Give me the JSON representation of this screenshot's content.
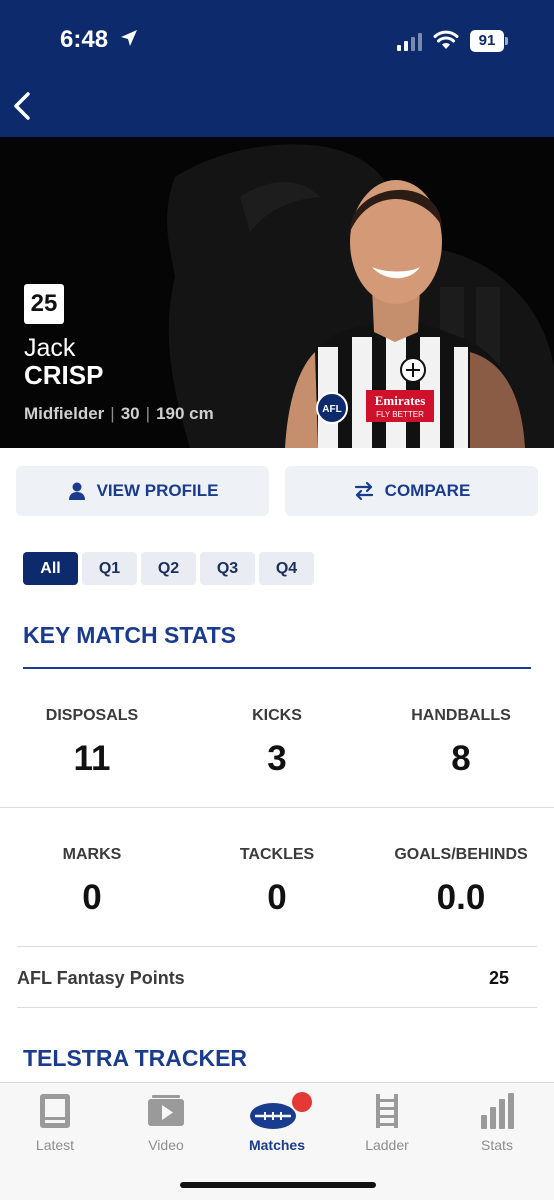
{
  "status_bar": {
    "time": "6:48",
    "battery": "91"
  },
  "player": {
    "number": "25",
    "first_name": "Jack",
    "last_name": "CRISP",
    "position": "Midfielder",
    "age": "30",
    "height": "190 cm",
    "photo_sponsor_text": "Emirates",
    "photo_sponsor_tagline": "FLY BETTER",
    "photo_logo_text": "AFL"
  },
  "actions": {
    "view_profile": "VIEW PROFILE",
    "compare": "COMPARE"
  },
  "quarters": {
    "selected": "All",
    "items": [
      "All",
      "Q1",
      "Q2",
      "Q3",
      "Q4"
    ]
  },
  "key_stats": {
    "title": "KEY MATCH STATS",
    "row1": [
      {
        "label": "DISPOSALS",
        "value": "11"
      },
      {
        "label": "KICKS",
        "value": "3"
      },
      {
        "label": "HANDBALLS",
        "value": "8"
      }
    ],
    "row2": [
      {
        "label": "MARKS",
        "value": "0"
      },
      {
        "label": "TACKLES",
        "value": "0"
      },
      {
        "label": "GOALS/BEHINDS",
        "value": "0.0"
      }
    ],
    "fantasy_label": "AFL Fantasy Points",
    "fantasy_value": "25"
  },
  "telstra_tracker": {
    "title": "TELSTRA TRACKER"
  },
  "tab_bar": {
    "active": "Matches",
    "items": [
      {
        "label": "Latest",
        "icon": "latest-icon"
      },
      {
        "label": "Video",
        "icon": "video-icon"
      },
      {
        "label": "Matches",
        "icon": "matches-football-icon"
      },
      {
        "label": "Ladder",
        "icon": "ladder-icon"
      },
      {
        "label": "Stats",
        "icon": "stats-bar-icon"
      }
    ]
  },
  "colors": {
    "navy": "#0d2a6c",
    "accent_blue": "#1a3c8f",
    "notification_red": "#e53935"
  }
}
